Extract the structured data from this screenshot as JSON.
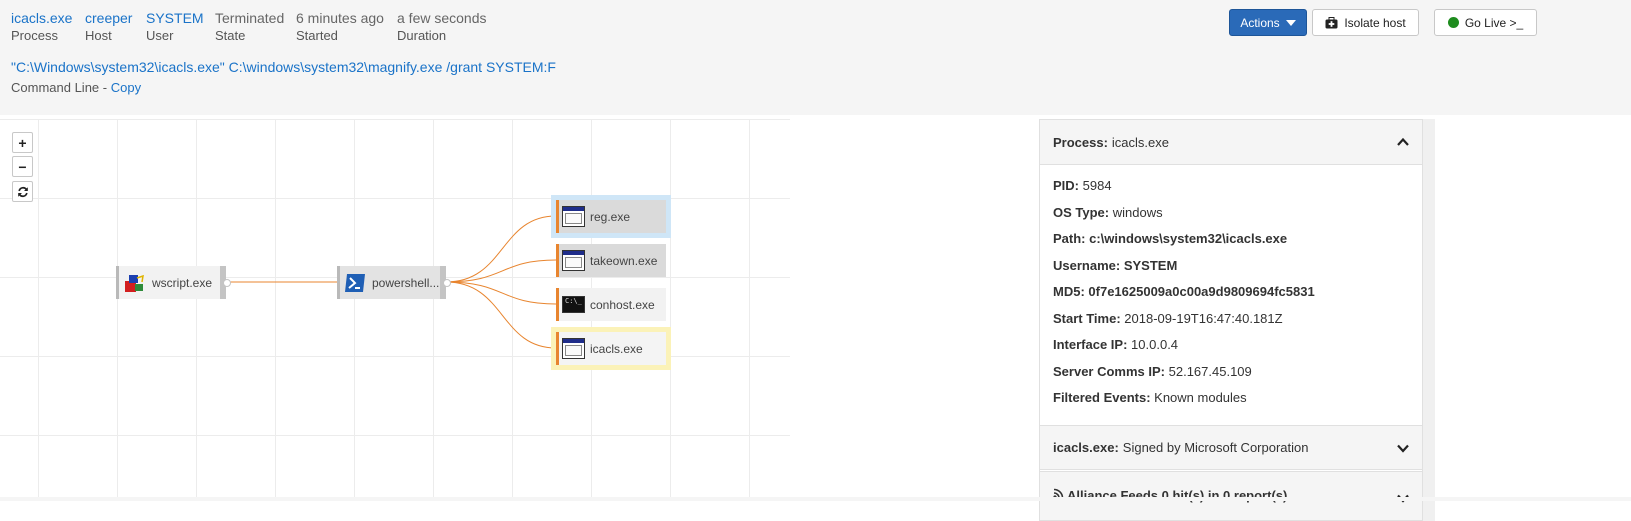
{
  "header": {
    "meta": [
      {
        "value": "icacls.exe",
        "label": "Process",
        "link": true
      },
      {
        "value": "creeper",
        "label": "Host",
        "link": true
      },
      {
        "value": "SYSTEM",
        "label": "User",
        "link": true
      },
      {
        "value": "Terminated",
        "label": "State",
        "link": false
      },
      {
        "value": "6 minutes ago",
        "label": "Started",
        "link": false
      },
      {
        "value": "a few seconds",
        "label": "Duration",
        "link": false
      }
    ],
    "command_line": "\"C:\\Windows\\system32\\icacls.exe\" C:\\windows\\system32\\magnify.exe /grant SYSTEM:F",
    "command_line_label": "Command Line - ",
    "copy_label": "Copy"
  },
  "toolbar": {
    "actions_label": "Actions",
    "isolate_label": "Isolate host",
    "golive_label": "Go Live >_"
  },
  "graph": {
    "zoom_in": "+",
    "zoom_out": "−",
    "reset": "refresh-icon",
    "nodes": {
      "wscript": "wscript.exe",
      "powershell": "powershell....",
      "reg": "reg.exe",
      "takeown": "takeown.exe",
      "conhost": "conhost.exe",
      "icacls": "icacls.exe"
    },
    "colors": {
      "edge": "#e8852f",
      "selected_highlight": "#fbf2b8",
      "hover_highlight": "#cfe6f7"
    }
  },
  "panel": {
    "process_head_key": "Process:",
    "process_head_val": "icacls.exe",
    "properties": [
      {
        "key": "PID:",
        "value": "5984",
        "bold": false
      },
      {
        "key": "OS Type:",
        "value": "windows",
        "bold": false
      },
      {
        "key": "Path:",
        "value": "c:\\windows\\system32\\icacls.exe",
        "bold": true
      },
      {
        "key": "Username:",
        "value": "SYSTEM",
        "bold": true
      },
      {
        "key": "MD5:",
        "value": "0f7e1625009a0c00a9d9809694fc5831",
        "bold": true
      },
      {
        "key": "Start Time:",
        "value": "2018-09-19T16:47:40.181Z",
        "bold": false
      },
      {
        "key": "Interface IP:",
        "value": "10.0.0.4",
        "bold": false
      },
      {
        "key": "Server Comms IP:",
        "value": "52.167.45.109",
        "bold": false
      },
      {
        "key": "Filtered Events:",
        "value": "Known modules",
        "bold": false
      }
    ],
    "signed_key": "icacls.exe:",
    "signed_val": "Signed by Microsoft Corporation",
    "alliance_label": "Alliance Feeds 0 hit(s) in 0 report(s)"
  }
}
